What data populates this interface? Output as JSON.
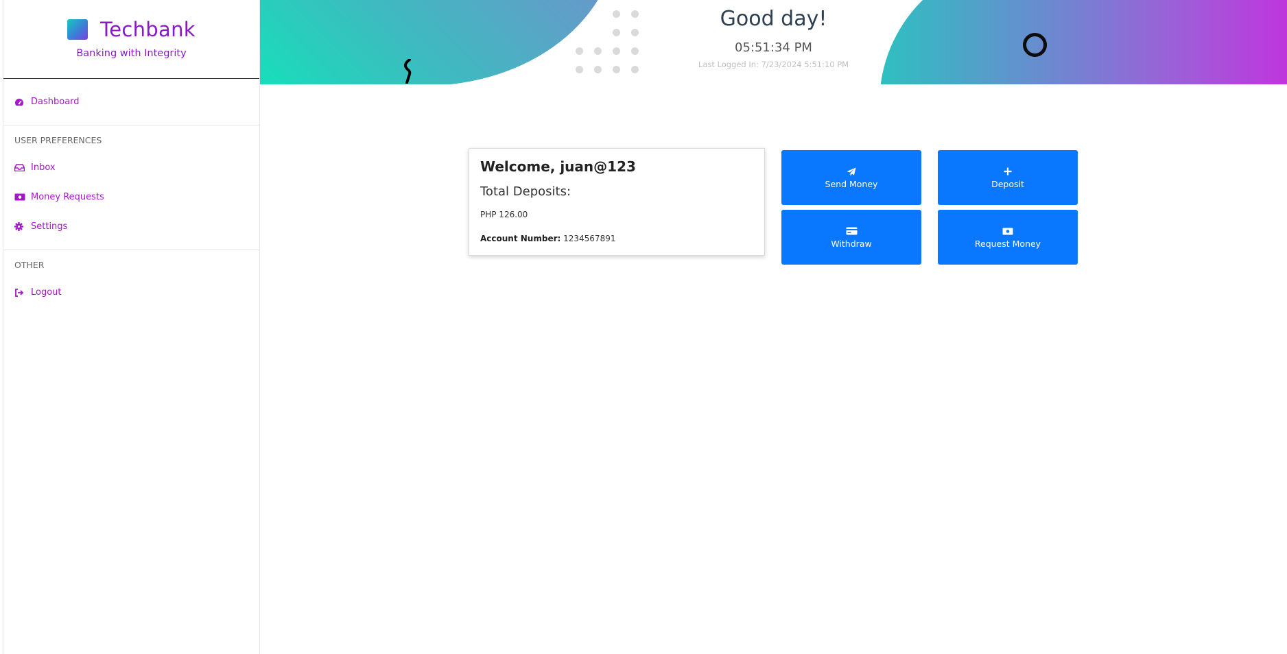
{
  "brand": {
    "name": "Techbank",
    "tagline": "Banking with Integrity"
  },
  "sidebar": {
    "items": [
      {
        "label": "Dashboard",
        "icon": "gauge-icon"
      }
    ],
    "sections": [
      {
        "heading": "USER PREFERENCES",
        "items": [
          {
            "label": "Inbox",
            "icon": "inbox-icon"
          },
          {
            "label": "Money Requests",
            "icon": "money-bill-icon"
          },
          {
            "label": "Settings",
            "icon": "gear-icon"
          }
        ]
      },
      {
        "heading": "OTHER",
        "items": [
          {
            "label": "Logout",
            "icon": "logout-icon"
          }
        ]
      }
    ]
  },
  "header": {
    "greeting": "Good day!",
    "time": "05:51:34 PM",
    "last_login": "Last Logged In: 7/23/2024 5:51:10 PM"
  },
  "card": {
    "welcome": "Welcome, juan@123",
    "deposits_label": "Total Deposits:",
    "amount": "PHP 126.00",
    "account_label": "Account Number:",
    "account_number": "1234567891"
  },
  "actions": [
    {
      "label": "Send Money",
      "icon": "paper-plane-icon"
    },
    {
      "label": "Deposit",
      "icon": "plus-icon"
    },
    {
      "label": "Withdraw",
      "icon": "credit-card-icon"
    },
    {
      "label": "Request Money",
      "icon": "money-bill-icon"
    }
  ],
  "colors": {
    "brand": "#8a18c9",
    "nav": "#a516c9",
    "button": "#0a78fe"
  }
}
